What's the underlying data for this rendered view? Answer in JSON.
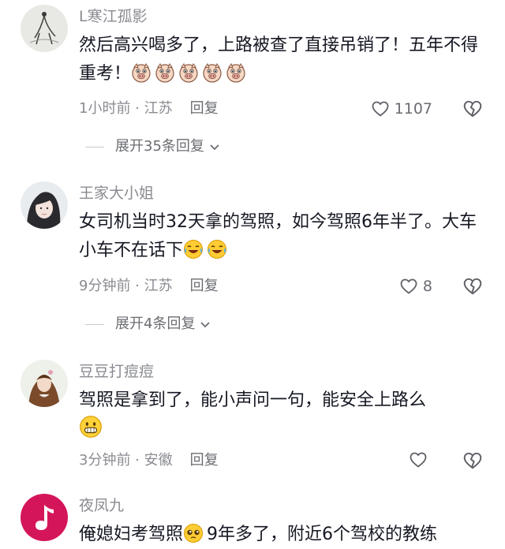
{
  "comments": [
    {
      "username": "L寒江孤影",
      "text": "然后高兴喝多了，上路被查了直接吊销了！五年不得重考！",
      "time": "1小时前",
      "location": "江苏",
      "reply_label": "回复",
      "likes": "1107",
      "expand_label": "展开35条回复"
    },
    {
      "username": "王家大小姐",
      "text": "女司机当时32天拿的驾照，如今驾照6年半了。大车小车不在话下",
      "time": "9分钟前",
      "location": "江苏",
      "reply_label": "回复",
      "likes": "8",
      "expand_label": "展开4条回复"
    },
    {
      "username": "豆豆打痘痘",
      "text": "驾照是拿到了，能小声问一句，能安全上路么",
      "time": "3分钟前",
      "location": "安徽",
      "reply_label": "回复",
      "likes": ""
    },
    {
      "username": "夜凤九",
      "text_before": "俺媳妇考驾照",
      "text_after": "9年多了，附近6个驾校的教练"
    }
  ],
  "separator": " · ",
  "icons": {
    "like": "heart-outline-icon",
    "dislike": "broken-heart-icon",
    "expand": "chevron-down-icon",
    "emoji_1": "pig-face-emoji",
    "emoji_2": "laugh-cry-emoji",
    "emoji_3": "grin-emoji",
    "emoji_4": "pleading-emoji"
  },
  "colors": {
    "text": "#161823",
    "secondary": "#8a8b91",
    "music_avatar": "#d4155a"
  }
}
